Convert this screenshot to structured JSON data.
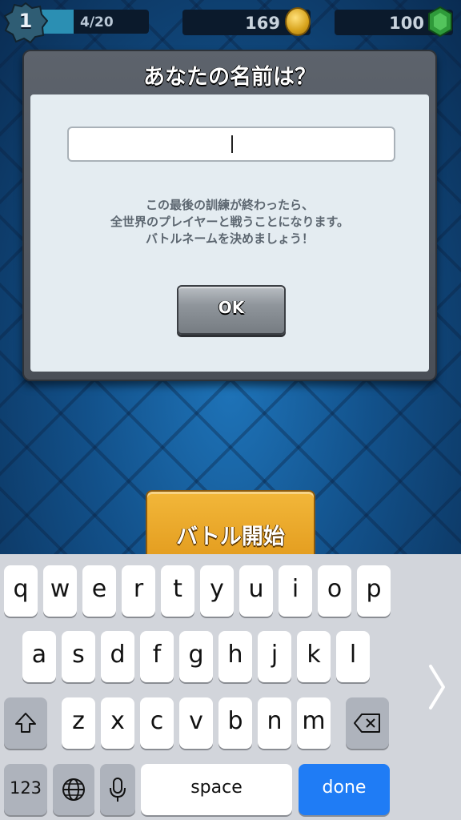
{
  "topbar": {
    "level": "1",
    "progress_text": "4/20",
    "progress_fraction": 0.2,
    "gold": "169",
    "gems": "100"
  },
  "dialog": {
    "title": "あなたの名前は？",
    "input_value": "",
    "message": "この最後の訓練が終わったら、\n全世界のプレイヤーと戦うことになります。\nバトルネームを決めましょう！",
    "ok_label": "OK"
  },
  "battle_button": {
    "label": "バトル開始"
  },
  "keyboard": {
    "row1": [
      "q",
      "w",
      "e",
      "r",
      "t",
      "y",
      "u",
      "i",
      "o",
      "p"
    ],
    "row2": [
      "a",
      "s",
      "d",
      "f",
      "g",
      "h",
      "j",
      "k",
      "l"
    ],
    "row3": [
      "z",
      "x",
      "c",
      "v",
      "b",
      "n",
      "m"
    ],
    "numbers_label": "123",
    "space_label": "space",
    "done_label": "done"
  },
  "colors": {
    "accent_done": "#1f7cf5",
    "battle_gold": "#f2b73a",
    "bg_blue": "#125089"
  },
  "icons": [
    "level-badge-icon",
    "coin-icon",
    "gem-icon",
    "shift-icon",
    "backspace-icon",
    "globe-icon",
    "mic-icon",
    "chevron-right-icon"
  ]
}
